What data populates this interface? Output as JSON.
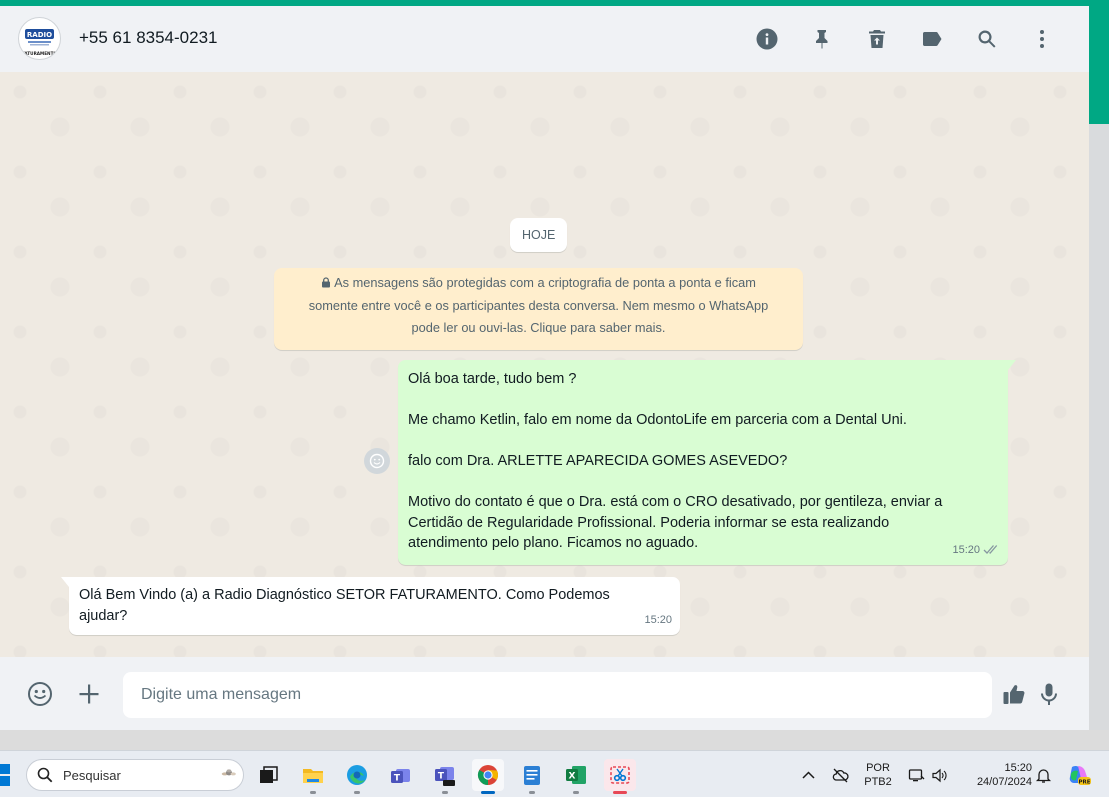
{
  "header": {
    "contact_name": "+55 61 8354-0231",
    "avatar_text_top": "RADIO",
    "avatar_text_bottom": "FATURAMENTO",
    "icons": [
      "info-icon",
      "pin-icon",
      "delete-icon",
      "label-icon",
      "search-icon",
      "menu-icon"
    ]
  },
  "chat": {
    "date_chip": "HOJE",
    "e2e_notice_line1": "As mensagens são protegidas com a criptografia de ponta a ponta e ficam",
    "e2e_notice_line2": "somente entre você e os participantes desta conversa. Nem mesmo o WhatsApp",
    "e2e_notice_line3": "pode ler ou ouvi-las. Clique para saber mais.",
    "outgoing": {
      "line1": "Olá boa tarde, tudo bem ?",
      "line2": "Me chamo Ketlin, falo em nome da OdontoLife em parceria com a Dental Uni.",
      "line3": "falo com Dra. ARLETTE APARECIDA GOMES ASEVEDO?",
      "line4": "Motivo do contato é que o Dra. está com o CRO desativado, por gentileza, enviar a",
      "line5": "Certidão de Regularidade Profissional. Poderia informar se esta realizando",
      "line6": "atendimento pelo plano. Ficamos no aguado.",
      "time": "15:20",
      "status": "read-double-tick"
    },
    "incoming": {
      "line1": "Olá Bem Vindo (a) a Radio Diagnóstico SETOR FATURAMENTO. Como Podemos",
      "line2": "ajudar?",
      "time": "15:20"
    }
  },
  "composer": {
    "placeholder": "Digite uma mensagem"
  },
  "taskbar": {
    "search_label": "Pesquisar",
    "lang_top": "POR",
    "lang_bottom": "PTB2",
    "time": "15:20",
    "date": "24/07/2024",
    "copilot_badge": "PRE"
  },
  "colors": {
    "accent": "#00a884",
    "outgoing_bubble": "#d9fdd3",
    "incoming_bubble": "#ffffff",
    "notice": "#ffeecd",
    "icon": "#54656f"
  }
}
